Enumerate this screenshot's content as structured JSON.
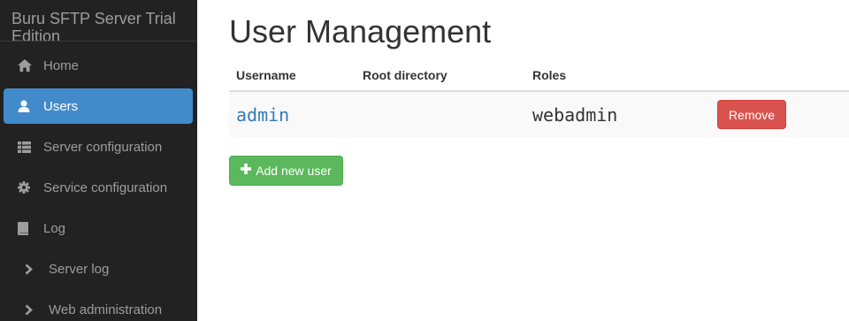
{
  "app": {
    "title": "Buru SFTP Server Trial Edition"
  },
  "sidebar": {
    "items": [
      {
        "label": "Home",
        "icon": "home-icon"
      },
      {
        "label": "Users",
        "icon": "user-icon",
        "active": true
      },
      {
        "label": "Server configuration",
        "icon": "list-icon"
      },
      {
        "label": "Service configuration",
        "icon": "gear-icon"
      },
      {
        "label": "Log",
        "icon": "book-icon"
      },
      {
        "label": "Server log",
        "icon": "chevron-right-icon"
      },
      {
        "label": "Web administration",
        "icon": "chevron-right-icon"
      }
    ],
    "active_color": "#428bca"
  },
  "main": {
    "title": "User Management",
    "table": {
      "headers": [
        "Username",
        "Root directory",
        "Roles",
        ""
      ],
      "rows": [
        {
          "username": "admin",
          "root_directory": "",
          "roles": "webadmin",
          "action": "Remove"
        }
      ]
    },
    "add_button": "Add new user"
  }
}
